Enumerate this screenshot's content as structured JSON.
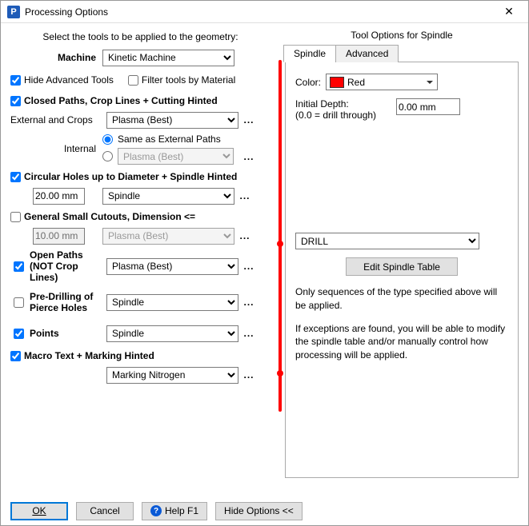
{
  "window": {
    "title": "Processing Options"
  },
  "left": {
    "instruction": "Select the tools to be applied to the geometry:",
    "machine_label": "Machine",
    "machine_value": "Kinetic Machine",
    "hide_advanced": "Hide Advanced Tools",
    "filter_material": "Filter tools by Material",
    "closed_paths_label": "Closed Paths,  Crop Lines  +  Cutting Hinted",
    "external_label": "External and Crops",
    "external_value": "Plasma (Best)",
    "internal_label": "Internal",
    "internal_same": "Same as External Paths",
    "internal_value": "Plasma (Best)",
    "circular_label": "Circular Holes up to Diameter   +  Spindle Hinted",
    "circular_dim": "20.00 mm",
    "circular_value": "Spindle",
    "small_cutouts_label": "General Small Cutouts, Dimension <=",
    "small_cutouts_dim": "10.00 mm",
    "small_cutouts_value": "Plasma (Best)",
    "open_paths_label": "Open Paths (NOT Crop Lines)",
    "open_paths_value": "Plasma (Best)",
    "predrill_label": "Pre-Drilling of Pierce Holes",
    "predrill_value": "Spindle",
    "points_label": "Points",
    "points_value": "Spindle",
    "macro_label": "Macro Text   +  Marking Hinted",
    "macro_value": "Marking Nitrogen",
    "ellipsis": "..."
  },
  "right": {
    "header": "Tool Options for Spindle",
    "tab_spindle": "Spindle",
    "tab_advanced": "Advanced",
    "color_label": "Color:",
    "color_name": "Red",
    "depth_label1": "Initial Depth:",
    "depth_label2": "(0.0 = drill through)",
    "depth_value": "0.00 mm",
    "sequence_value": "DRILL",
    "edit_table": "Edit Spindle Table",
    "note1": "Only sequences of the type specified above will be applied.",
    "note2": " If exceptions are found, you will be able to modify the spindle table and/or manually control how processing will be applied."
  },
  "buttons": {
    "ok": "OK",
    "cancel": "Cancel",
    "help": "Help F1",
    "hide": "Hide Options <<"
  }
}
